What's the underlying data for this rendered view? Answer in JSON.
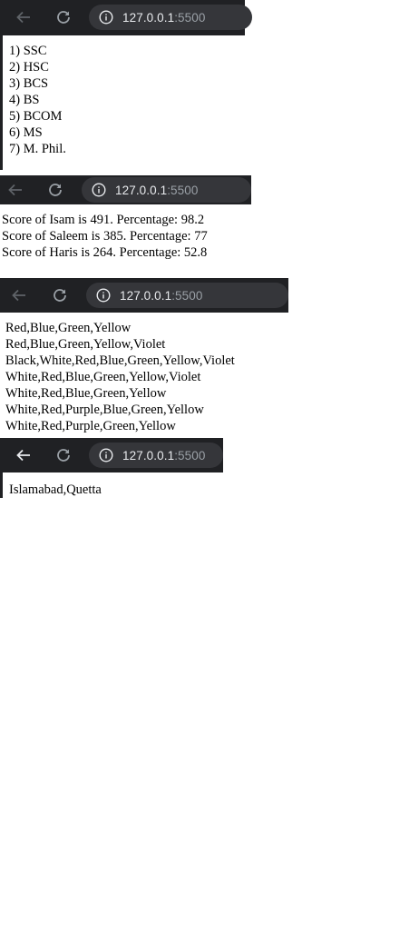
{
  "browser": {
    "url_host": "127.0.0.1",
    "url_port": ":5500"
  },
  "education": {
    "items": [
      "1) SSC",
      "2) HSC",
      "3) BCS",
      "4) BS",
      "5) BCOM",
      "6) MS",
      "7) M. Phil."
    ]
  },
  "scores": {
    "lines": [
      "Score of Isam is 491. Percentage: 98.2",
      "Score of Saleem is 385. Percentage: 77",
      "Score of Haris is 264. Percentage: 52.8"
    ]
  },
  "colors": {
    "lines": [
      "Red,Blue,Green,Yellow",
      "Red,Blue,Green,Yellow,Violet",
      "Black,White,Red,Blue,Green,Yellow,Violet",
      "White,Red,Blue,Green,Yellow,Violet",
      "White,Red,Blue,Green,Yellow",
      "White,Red,Purple,Blue,Green,Yellow",
      "White,Red,Purple,Green,Yellow"
    ]
  },
  "cities": {
    "text": "Islamabad,Quetta"
  }
}
